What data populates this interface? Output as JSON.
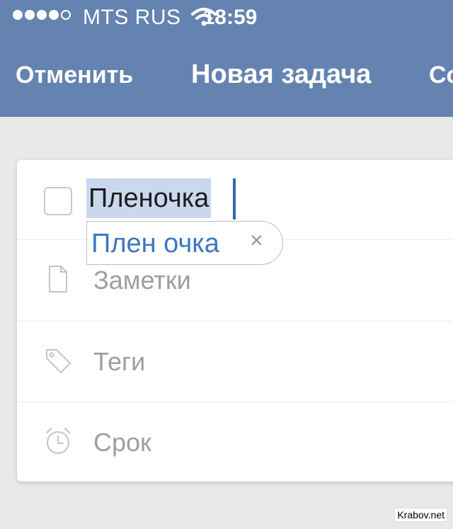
{
  "status_bar": {
    "carrier": "MTS RUS",
    "time": "18:59",
    "signal_bars": 4,
    "signal_total": 5,
    "signal_icon": "signal-dots-icon",
    "wifi_icon": "wifi-icon"
  },
  "nav": {
    "cancel_label": "Отменить",
    "title": "Новая задача",
    "save_label": "Со"
  },
  "task": {
    "title_value": "Пленочка",
    "checkbox_checked": false
  },
  "autocorrect": {
    "suggestion": "Плен очка",
    "close_symbol": "×"
  },
  "fields": [
    {
      "label": "Заметки",
      "icon": "document-icon"
    },
    {
      "label": "Теги",
      "icon": "tag-icon"
    },
    {
      "label": "Срок",
      "icon": "alarm-clock-icon"
    }
  ],
  "watermark": "Krabov.net",
  "colors": {
    "nav_background": "#6483b0",
    "selection": "#c9d8ef",
    "caret": "#3367b8",
    "suggestion_text": "#3b78c0",
    "placeholder": "#9e9e9e"
  }
}
